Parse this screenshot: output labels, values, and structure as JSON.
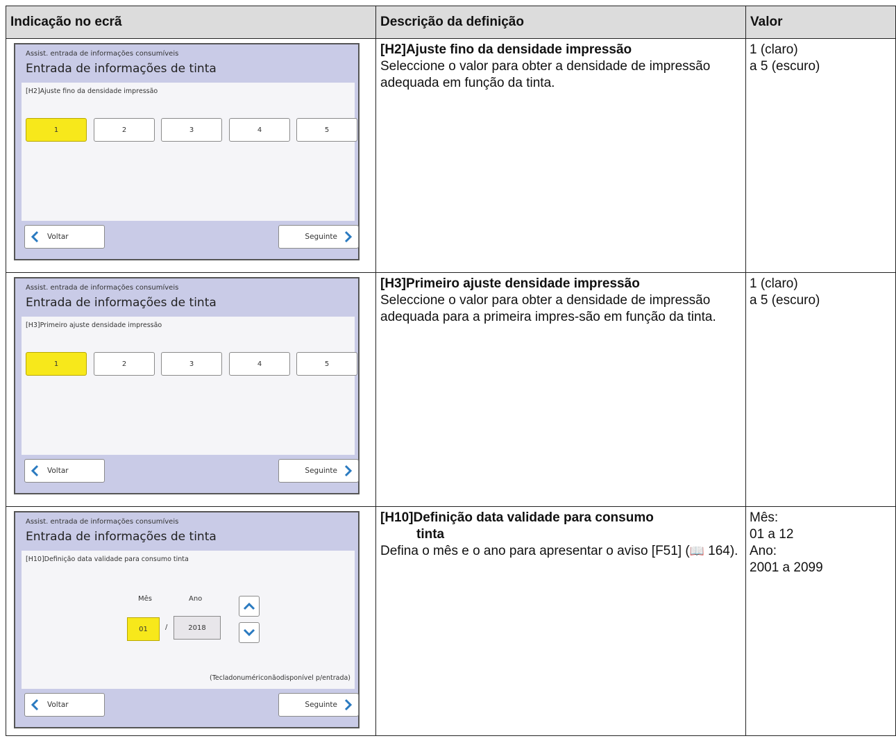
{
  "table": {
    "headers": [
      "Indicação no ecrã",
      "Descrição da definição",
      "Valor"
    ],
    "rows": [
      {
        "desc_title": "[H2]Ajuste fino da densidade impressão",
        "desc_title_cont": "",
        "desc_text": "Seleccione o valor para obter a densidade de impressão adequada em função da tinta.",
        "value_lines": [
          "1 (claro)",
          "a 5 (escuro)"
        ],
        "screen": {
          "header": "Assist. entrada de informações consumíveis",
          "title": "Entrada de informações de tinta",
          "panel_label": "[H2]Ajuste fino da densidade impressão",
          "options": [
            "1",
            "2",
            "3",
            "4",
            "5"
          ],
          "selected": "1",
          "back": "Voltar",
          "next": "Seguinte"
        }
      },
      {
        "desc_title": "[H3]Primeiro ajuste densidade impressão",
        "desc_title_cont": "",
        "desc_text": "Seleccione o valor para obter a densidade de impressão adequada para a primeira impres-são em função da tinta.",
        "value_lines": [
          "1 (claro)",
          "a 5 (escuro)"
        ],
        "screen": {
          "header": "Assist. entrada de informações consumíveis",
          "title": "Entrada de informações de tinta",
          "panel_label": "[H3]Primeiro ajuste densidade impressão",
          "options": [
            "1",
            "2",
            "3",
            "4",
            "5"
          ],
          "selected": "1",
          "back": "Voltar",
          "next": "Seguinte"
        }
      },
      {
        "desc_title": "[H10]Definição data validade para consumo",
        "desc_title_cont": "tinta",
        "desc_text_before": "Defina o mês e o ano para apresentar o aviso [F51] (",
        "desc_ref_page": "164",
        "desc_text_after": ").",
        "value_lines": [
          "Mês:",
          "01 a 12",
          "Ano:",
          "2001 a 2099"
        ],
        "screen": {
          "header": "Assist. entrada de informações consumíveis",
          "title": "Entrada de informações de tinta",
          "panel_label": "[H10]Definição data validade para consumo tinta",
          "month_label": "Mês",
          "year_label": "Ano",
          "month_value": "01",
          "separator": "/",
          "year_value": "2018",
          "note": "(Tecladonumériconãodisponível p/entrada)",
          "back": "Voltar",
          "next": "Seguinte"
        }
      }
    ]
  },
  "icons": {
    "back": "chevron-left-icon",
    "next": "chevron-right-icon",
    "up": "chevron-up-icon",
    "down": "chevron-down-icon",
    "reference": "book-icon"
  },
  "colors": {
    "selected": "#f7e81b",
    "screen_bg": "#c9cbe7",
    "arrow": "#2a7ac0",
    "header_bg": "#dcdcdc"
  }
}
